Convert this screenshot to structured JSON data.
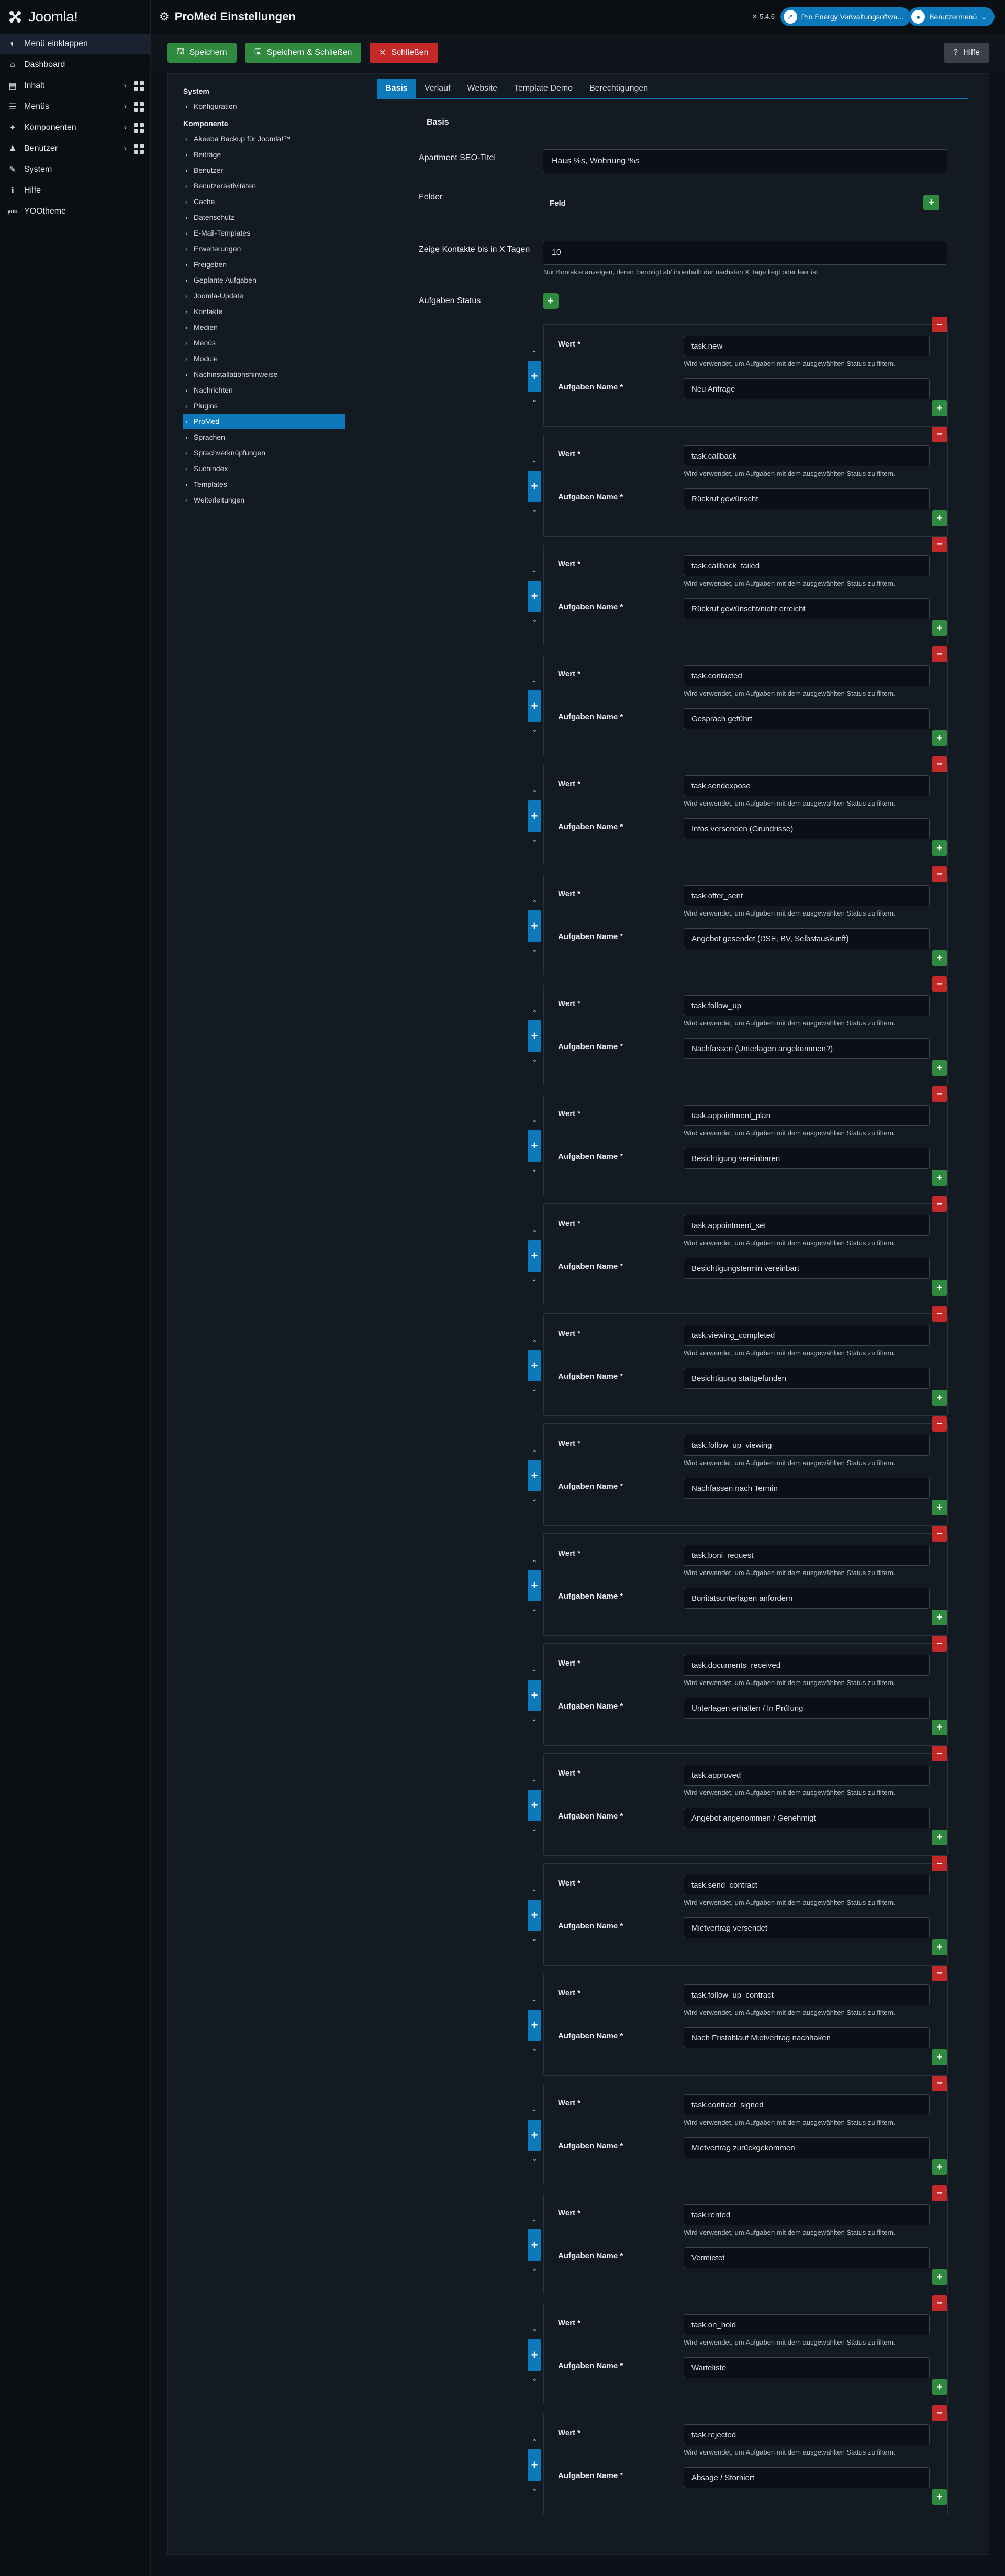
{
  "brand": {
    "name": "Joomla!"
  },
  "sidebar": {
    "items": [
      {
        "label": "Menü einklappen",
        "icon": "toggle-icon"
      },
      {
        "label": "Dashboard",
        "icon": "home-icon"
      },
      {
        "label": "Inhalt",
        "icon": "file-icon"
      },
      {
        "label": "Menüs",
        "icon": "list-icon"
      },
      {
        "label": "Komponenten",
        "icon": "puzzle-icon"
      },
      {
        "label": "Benutzer",
        "icon": "users-icon"
      },
      {
        "label": "System",
        "icon": "wrench-icon"
      },
      {
        "label": "Hilfe",
        "icon": "info-icon"
      },
      {
        "label": "YOOtheme",
        "icon": "yoo-icon"
      }
    ]
  },
  "header": {
    "title": "ProMed Einstellungen",
    "version": "5.4.6",
    "site_link": "Pro Energy Verwaltungsoftwa...",
    "user_menu": "Benutzermenü"
  },
  "toolbar": {
    "save": "Speichern",
    "save_close": "Speichern & Schließen",
    "close": "Schließen",
    "help": "Hilfe"
  },
  "tree": {
    "system_head": "System",
    "system_items": [
      "Konfiguration"
    ],
    "components_head": "Komponente",
    "components": [
      "Akeeba Backup für Joomla!™",
      "Beiträge",
      "Benutzer",
      "Benutzeraktivitäten",
      "Cache",
      "Datenschutz",
      "E-Mail-Templates",
      "Erweiterungen",
      "Freigeben",
      "Geplante Aufgaben",
      "Joomla-Update",
      "Kontakte",
      "Medien",
      "Menüs",
      "Module",
      "Nachinstallationshinweise",
      "Nachrichten",
      "Plugins",
      "ProMed",
      "Sprachen",
      "Sprachverknüpfungen",
      "Suchindex",
      "Templates",
      "Weiterleitungen"
    ],
    "selected": "ProMed"
  },
  "tabs": [
    "Basis",
    "Verlauf",
    "Website",
    "Template Demo",
    "Berechtigungen"
  ],
  "form": {
    "section": "Basis",
    "seo_label": "Apartment SEO-Titel",
    "seo_value": "Haus %s, Wohnung %s",
    "fields_label": "Felder",
    "fields_col": "Feld",
    "days_label": "Zeige Kontakte bis in X Tagen",
    "days_value": "10",
    "days_desc": "Nur Kontakte anzeigen, deren 'benötigt ab' innerhalb der nächsten X Tage liegt oder leer ist.",
    "status_label": "Aufgaben Status",
    "value_label": "Wert *",
    "name_label": "Aufgaben Name *",
    "value_desc": "Wird verwendet, um Aufgaben mit dem ausgewählten Status zu filtern."
  },
  "status_rows": [
    {
      "value": "task.new",
      "name": "Neu Anfrage"
    },
    {
      "value": "task.callback",
      "name": "Rückruf gewünscht"
    },
    {
      "value": "task.callback_failed",
      "name": "Rückruf gewünscht/nicht erreicht"
    },
    {
      "value": "task.contacted",
      "name": "Gespräch geführt"
    },
    {
      "value": "task.sendexpose",
      "name": "Infos versenden (Grundrisse)"
    },
    {
      "value": "task.offer_sent",
      "name": "Angebot gesendet (DSE, BV, Selbstauskunft)"
    },
    {
      "value": "task.follow_up",
      "name": "Nachfassen (Unterlagen angekommen?)"
    },
    {
      "value": "task.appointment_plan",
      "name": "Besichtigung vereinbaren"
    },
    {
      "value": "task.appointment_set",
      "name": "Besichtigungstermin vereinbart"
    },
    {
      "value": "task.viewing_completed",
      "name": "Besichtigung stattgefunden"
    },
    {
      "value": "task.follow_up_viewing",
      "name": "Nachfassen nach Termin"
    },
    {
      "value": "task.boni_request",
      "name": "Bonitätsunterlagen anfordern"
    },
    {
      "value": "task.documents_received",
      "name": "Unterlagen erhalten / In Prüfung"
    },
    {
      "value": "task.approved",
      "name": "Angebot angenommen / Genehmigt"
    },
    {
      "value": "task.send_contract",
      "name": "Mietvertrag versendet"
    },
    {
      "value": "task.follow_up_contract",
      "name": "Nach Fristablauf Mietvertrag nachhaken"
    },
    {
      "value": "task.contract_signed",
      "name": "Mietvertrag zurückgekommen"
    },
    {
      "value": "task.rented",
      "name": "Vermietet"
    },
    {
      "value": "task.on_hold",
      "name": "Warteliste"
    },
    {
      "value": "task.rejected",
      "name": "Absage / Storniert"
    }
  ],
  "colors": {
    "primary": "#0d79ba",
    "success": "#2f8a3f",
    "danger": "#c52828",
    "background": "#0e1218"
  }
}
